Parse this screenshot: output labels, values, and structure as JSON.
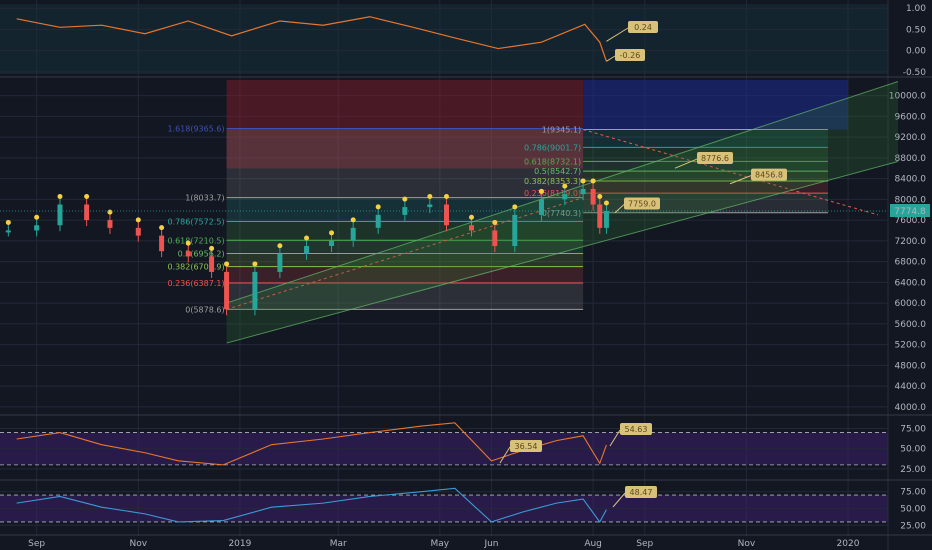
{
  "colors": {
    "background": "#131722",
    "grid": "#232838",
    "price_up": "#26a69a",
    "price_down": "#ef5350",
    "dot_yellow": "#f5d142",
    "orange_line": "#e8762b",
    "blue_line": "#3d9ad6",
    "callout_fill": "#d8c27a",
    "last_price_fill": "#26a69a"
  },
  "chart_data": [
    {
      "type": "line",
      "panel": "correlation",
      "x": [
        "2018-08-20",
        "2018-09-15",
        "2018-10-10",
        "2018-11-05",
        "2018-12-01",
        "2018-12-27",
        "2019-01-25",
        "2019-02-20",
        "2019-03-20",
        "2019-04-15",
        "2019-05-10",
        "2019-06-05",
        "2019-07-01",
        "2019-07-27",
        "2019-08-05",
        "2019-08-09"
      ],
      "series": [
        {
          "values": [
            0.75,
            0.55,
            0.6,
            0.4,
            0.7,
            0.35,
            0.7,
            0.6,
            0.8,
            0.55,
            0.3,
            0.05,
            0.2,
            0.62,
            0.2,
            -0.25
          ]
        }
      ],
      "ylim": [
        -0.55,
        1.1
      ],
      "yticks": [
        "1.00",
        "0.50",
        "0.00",
        "-0.50"
      ],
      "yticks_values": [
        1.0,
        0.5,
        0.0,
        -0.5
      ],
      "callouts": [
        "0.24",
        "-0.26"
      ],
      "grid": true
    },
    {
      "type": "candlestick",
      "panel": "price",
      "x": [
        "2018-08-15",
        "2018-09-01",
        "2018-09-15",
        "2018-10-01",
        "2018-10-15",
        "2018-11-01",
        "2018-11-15",
        "2018-12-01",
        "2018-12-15",
        "2018-12-24",
        "2019-01-10",
        "2019-01-25",
        "2019-02-10",
        "2019-02-25",
        "2019-03-10",
        "2019-03-25",
        "2019-04-10",
        "2019-04-25",
        "2019-05-05",
        "2019-05-20",
        "2019-06-03",
        "2019-06-15",
        "2019-07-01",
        "2019-07-15",
        "2019-07-26",
        "2019-08-01",
        "2019-08-05",
        "2019-08-09"
      ],
      "values": [
        7400,
        7500,
        7900,
        7600,
        7450,
        7300,
        7000,
        6900,
        6600,
        5880,
        6600,
        6950,
        7100,
        7200,
        7450,
        7700,
        7850,
        7900,
        7500,
        7400,
        7100,
        7700,
        8000,
        8100,
        8200,
        7900,
        7450,
        7774.8
      ],
      "ylim": [
        3900,
        10300
      ],
      "yticks": [
        "10000.0",
        "9600.0",
        "9200.0",
        "8800.0",
        "8400.0",
        "8000.0",
        "7600.0",
        "7200.0",
        "6800.0",
        "6400.0",
        "6000.0",
        "5600.0",
        "5200.0",
        "4800.0",
        "4400.0",
        "4000.0"
      ],
      "yticks_values": [
        10000,
        9600,
        9200,
        8800,
        8400,
        8000,
        7600,
        7200,
        6800,
        6400,
        6000,
        5600,
        5200,
        4800,
        4400,
        4000
      ],
      "last_price_label": "7774.8",
      "last_price": 7774.8,
      "fib_retracement": {
        "start": "2018-12-24",
        "end": "2019-07-26",
        "levels": [
          {
            "label": "1.618(9365.6)",
            "price": 9365.6,
            "color": "#3f51b5"
          },
          {
            "label": "1(8033.7)",
            "price": 8033.7,
            "color": "#9e9e9e"
          },
          {
            "label": "0.786(7572.5)",
            "price": 7572.5,
            "color": "#26a69a"
          },
          {
            "label": "0.618(7210.5)",
            "price": 7210.5,
            "color": "#4caf50"
          },
          {
            "label": "0.5(6956.2)",
            "price": 6956.2,
            "color": "#66bb6a"
          },
          {
            "label": "0.382(6701.9)",
            "price": 6701.9,
            "color": "#8bc34a"
          },
          {
            "label": "0.236(6387.1)",
            "price": 6387.1,
            "color": "#ef5350"
          },
          {
            "label": "0(5878.6)",
            "price": 5878.6,
            "color": "#9e9e9e"
          }
        ]
      },
      "fib_extension": {
        "start": "2019-07-26",
        "end": "2019-12-20",
        "levels": [
          {
            "label": "1(9345.1)",
            "price": 9345.1,
            "color": "#9e9e9e"
          },
          {
            "label": "0.786(9001.7)",
            "price": 9001.7,
            "color": "#26a69a"
          },
          {
            "label": "0.618(8732.1)",
            "price": 8732.1,
            "color": "#4caf50"
          },
          {
            "label": "0.5(8542.7)",
            "price": 8542.7,
            "color": "#66bb6a"
          },
          {
            "label": "0.382(8353.3)",
            "price": 8353.3,
            "color": "#8bc34a"
          },
          {
            "label": "0.236(8119.0)",
            "price": 8119.0,
            "color": "#ef5350"
          },
          {
            "label": "0(7740.3)",
            "price": 7740.3,
            "color": "#9e9e9e"
          }
        ]
      },
      "callouts": [
        "8776.6",
        "8456.8",
        "7759.0"
      ],
      "grid": true
    },
    {
      "type": "line",
      "panel": "rsi-orange",
      "x": [
        "2018-08-20",
        "2018-09-15",
        "2018-10-10",
        "2018-11-05",
        "2018-11-25",
        "2018-12-22",
        "2019-01-20",
        "2019-02-20",
        "2019-03-20",
        "2019-04-20",
        "2019-05-10",
        "2019-06-01",
        "2019-06-20",
        "2019-07-10",
        "2019-07-26",
        "2019-08-05",
        "2019-08-09"
      ],
      "series": [
        {
          "values": [
            62,
            70,
            55,
            45,
            35,
            30,
            55,
            62,
            70,
            78,
            82,
            35,
            48,
            60,
            66,
            32,
            54.6
          ]
        }
      ],
      "ylim": [
        15,
        88
      ],
      "yticks": [
        "75.00",
        "50.00",
        "25.00"
      ],
      "yticks_values": [
        75,
        50,
        25
      ],
      "bands": [
        70,
        30
      ],
      "callouts": [
        "36.54",
        "54.63"
      ],
      "grid": true
    },
    {
      "type": "line",
      "panel": "rsi-blue",
      "x": [
        "2018-08-20",
        "2018-09-15",
        "2018-10-10",
        "2018-11-05",
        "2018-11-25",
        "2018-12-22",
        "2019-01-20",
        "2019-02-20",
        "2019-03-20",
        "2019-04-20",
        "2019-05-10",
        "2019-06-01",
        "2019-06-20",
        "2019-07-10",
        "2019-07-26",
        "2019-08-05",
        "2019-08-09"
      ],
      "series": [
        {
          "values": [
            58,
            68,
            52,
            42,
            30,
            32,
            52,
            58,
            68,
            75,
            80,
            30,
            45,
            58,
            64,
            30,
            48.4
          ]
        }
      ],
      "ylim": [
        15,
        88
      ],
      "yticks": [
        "75.00",
        "50.00",
        "25.00"
      ],
      "yticks_values": [
        75,
        50,
        25
      ],
      "bands": [
        70,
        30
      ],
      "callouts": [
        "48.47"
      ],
      "grid": true
    }
  ],
  "time_axis": {
    "labels": [
      {
        "text": "Sep",
        "date": "2018-09-01"
      },
      {
        "text": "Nov",
        "date": "2018-11-01"
      },
      {
        "text": "2019",
        "date": "2019-01-01"
      },
      {
        "text": "Mar",
        "date": "2019-03-01"
      },
      {
        "text": "May",
        "date": "2019-05-01"
      },
      {
        "text": "Jun",
        "date": "2019-06-01"
      },
      {
        "text": "Aug",
        "date": "2019-08-01"
      },
      {
        "text": "Sep",
        "date": "2019-09-01"
      },
      {
        "text": "Nov",
        "date": "2019-11-01"
      },
      {
        "text": "2020",
        "date": "2020-01-01"
      }
    ],
    "range": [
      "2018-08-10",
      "2020-01-25"
    ]
  }
}
